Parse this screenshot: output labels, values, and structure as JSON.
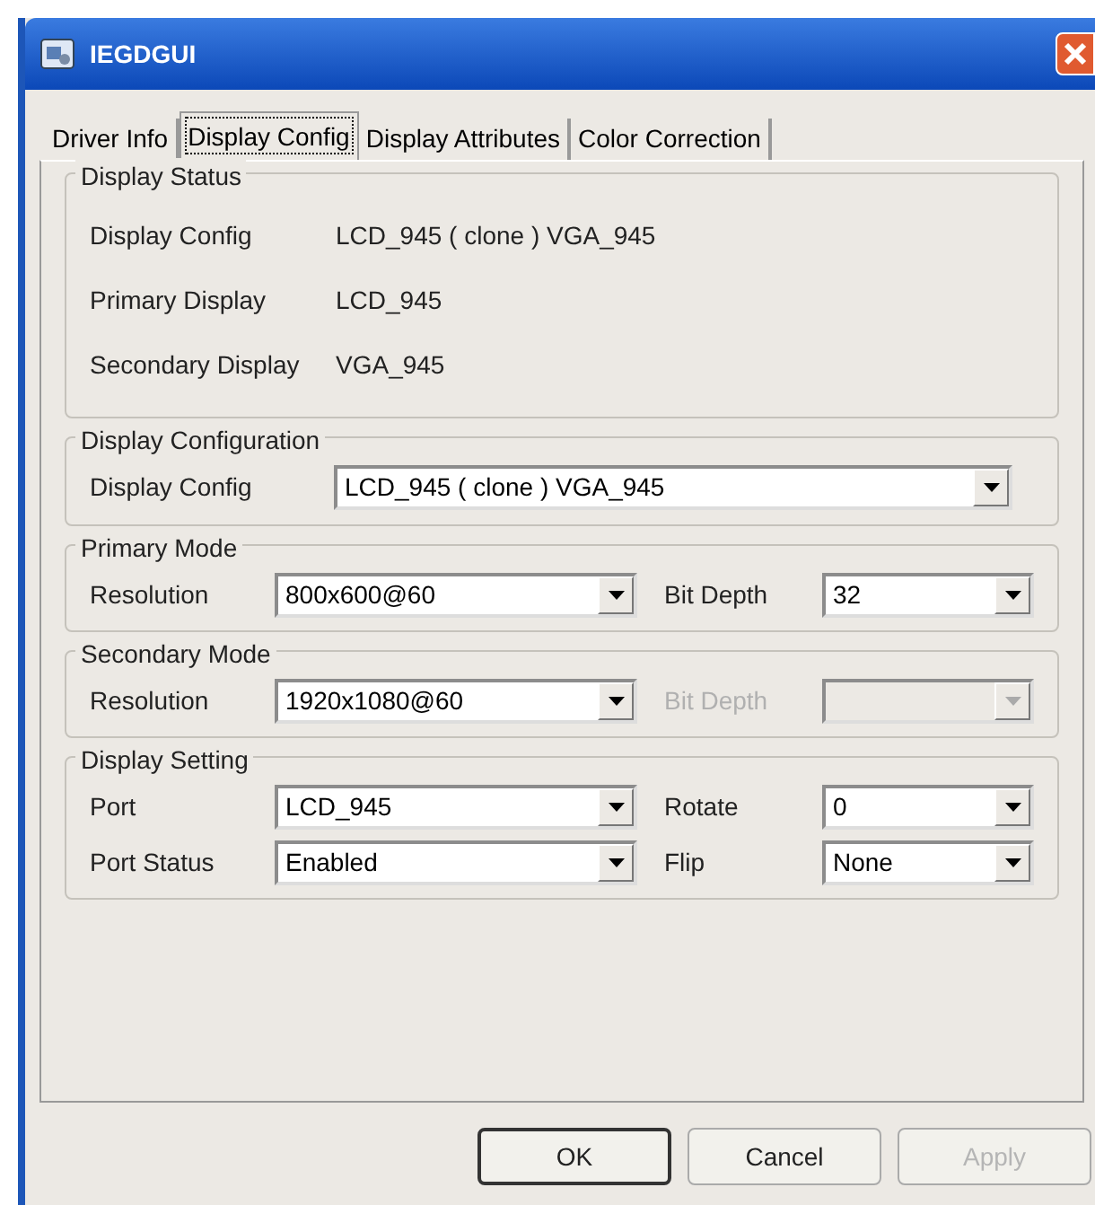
{
  "window": {
    "title": "IEGDGUI"
  },
  "tabs": [
    {
      "label": "Driver Info",
      "selected": false
    },
    {
      "label": "Display Config",
      "selected": true
    },
    {
      "label": "Display Attributes",
      "selected": false
    },
    {
      "label": "Color Correction",
      "selected": false
    }
  ],
  "groups": [
    {
      "kind": "status",
      "title": "Display Status",
      "rows": [
        {
          "label": "Display Config",
          "value": "LCD_945 ( clone ) VGA_945"
        },
        {
          "label": "Primary Display",
          "value": "LCD_945"
        },
        {
          "label": "Secondary Display",
          "value": "VGA_945"
        }
      ]
    },
    {
      "kind": "single",
      "title": "Display Configuration",
      "rows": [
        [
          {
            "label": "Display Config",
            "value": "LCD_945 ( clone ) VGA_945",
            "disabled": false
          }
        ]
      ]
    },
    {
      "kind": "pair",
      "title": "Primary Mode",
      "rows": [
        [
          {
            "label": "Resolution",
            "value": "800x600@60",
            "disabled": false
          },
          {
            "label": "Bit Depth",
            "value": "32",
            "disabled": false
          }
        ]
      ]
    },
    {
      "kind": "pair",
      "title": "Secondary Mode",
      "rows": [
        [
          {
            "label": "Resolution",
            "value": "1920x1080@60",
            "disabled": false
          },
          {
            "label": "Bit Depth",
            "disabled": true
          }
        ]
      ]
    },
    {
      "kind": "pair",
      "title": "Display Setting",
      "rows": [
        [
          {
            "label": "Port",
            "value": "LCD_945",
            "disabled": false
          },
          {
            "label": "Rotate",
            "value": "0",
            "disabled": false
          }
        ],
        [
          {
            "label": "Port Status",
            "value": "Enabled",
            "disabled": false
          },
          {
            "label": "Flip",
            "value": "None",
            "disabled": false
          }
        ]
      ]
    }
  ],
  "buttons": [
    {
      "label": "OK",
      "default": true,
      "disabled": false
    },
    {
      "label": "Cancel",
      "default": false,
      "disabled": false
    },
    {
      "label": "Apply",
      "default": false,
      "disabled": true
    }
  ]
}
